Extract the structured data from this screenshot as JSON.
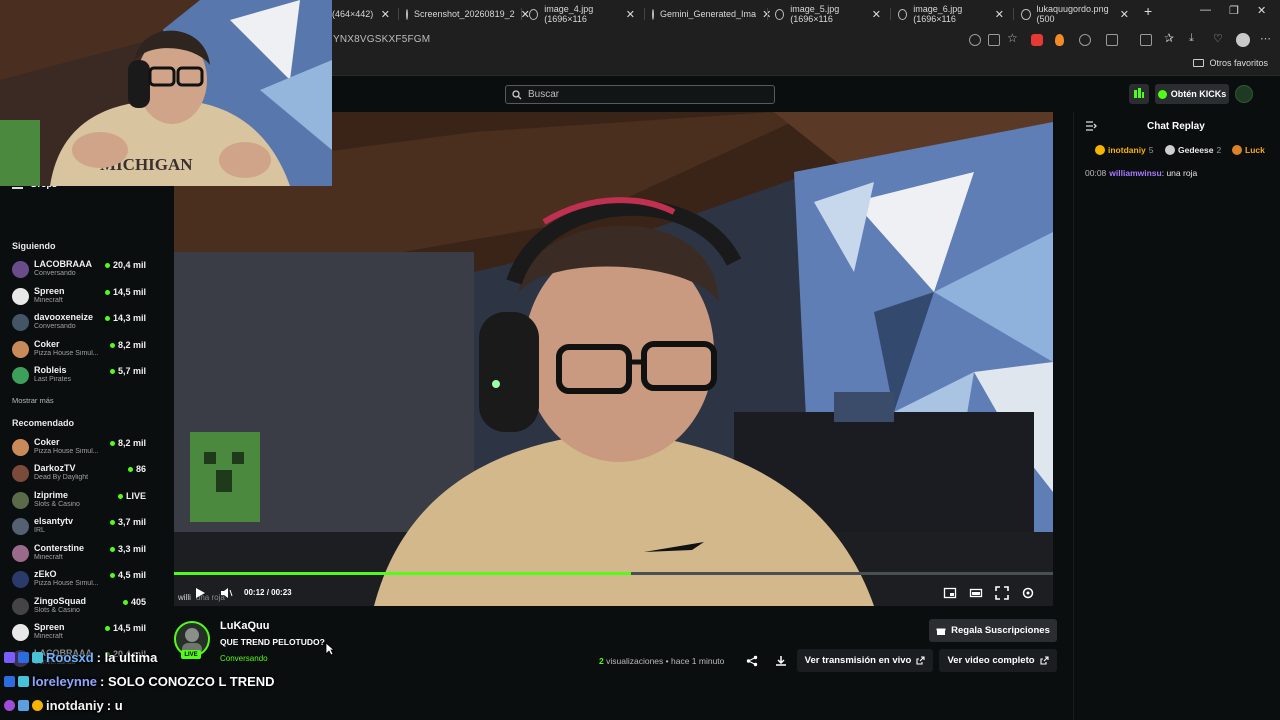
{
  "browser": {
    "tabs": [
      {
        "label": "(464×442)"
      },
      {
        "label": "Screenshot_20260819_2"
      },
      {
        "label": "image_4.jpg (1696×116"
      },
      {
        "label": "Gemini_Generated_Ima"
      },
      {
        "label": "image_5.jpg (1696×116"
      },
      {
        "label": "image_6.jpg (1696×116"
      },
      {
        "label": "lukaquugordo.png (500"
      }
    ],
    "url": "YNX8VGSKXF5FGM",
    "bookmarks_folder": "Otros favoritos"
  },
  "header": {
    "search_placeholder": "Buscar",
    "kicks_button": "Obtén KICKs"
  },
  "sidebar": {
    "partial_label": "Siguiendo",
    "drops_label": "Drops",
    "following_title": "Siguiendo",
    "following": [
      {
        "name": "LACOBRAAA",
        "category": "Conversando",
        "count": "20,4 mil",
        "color": "#6b4c8a"
      },
      {
        "name": "Spreen",
        "category": "Minecraft",
        "count": "14,5 mil",
        "color": "#e8e8e8"
      },
      {
        "name": "davooxeneize",
        "category": "Conversando",
        "count": "14,3 mil",
        "color": "#445566"
      },
      {
        "name": "Coker",
        "category": "Pizza House Simul...",
        "count": "8,2 mil",
        "color": "#c98a5a"
      },
      {
        "name": "Robleis",
        "category": "Last Pirates",
        "count": "5,7 mil",
        "color": "#3ca05a"
      }
    ],
    "show_more": "Mostrar más",
    "recommended_title": "Recomendado",
    "recommended": [
      {
        "name": "Coker",
        "category": "Pizza House Simul...",
        "count": "8,2 mil",
        "color": "#c98a5a"
      },
      {
        "name": "DarkozTV",
        "category": "Dead By Daylight",
        "count": "86",
        "color": "#7a4a3a"
      },
      {
        "name": "Iziprime",
        "category": "Slots & Casino",
        "count": "LIVE",
        "color": "#5a6a4a"
      },
      {
        "name": "elsantytv",
        "category": "IRL",
        "count": "3,7 mil",
        "color": "#556070"
      },
      {
        "name": "Conterstine",
        "category": "Minecraft",
        "count": "3,3 mil",
        "color": "#9a6a8a"
      },
      {
        "name": "zEkO",
        "category": "Pizza House Simul...",
        "count": "4,5 mil",
        "color": "#2a3a6a"
      },
      {
        "name": "ZingoSquad",
        "category": "Slots & Casino",
        "count": "405",
        "color": "#444444"
      },
      {
        "name": "Spreen",
        "category": "Minecraft",
        "count": "14,5 mil",
        "color": "#e8e8e8"
      },
      {
        "name": "LACOBRAAA",
        "category": "Conversando",
        "count": "20,4 mil",
        "color": "#6b4c8a"
      }
    ]
  },
  "player": {
    "current_time": "00:12",
    "duration": "00:23",
    "progress": 0.52,
    "video_watermark_user": "willi"
  },
  "channel": {
    "name": "LuKaQuu",
    "title": "QUE TREND PELOTUDO?",
    "category": "Conversando",
    "live_label": "LIVE",
    "subs_button": "Regala Suscripciones",
    "views_count": "2",
    "views_text": "visualizaciones",
    "time_ago": "hace 1 minuto",
    "live_button": "Ver transmisión en vivo",
    "full_video_button": "Ver video completo"
  },
  "chat": {
    "title": "Chat Replay",
    "gifters": [
      {
        "name": "inotdaniy",
        "count": "5",
        "color": "#f5b400",
        "badge": "#f5b400"
      },
      {
        "name": "Gedeese",
        "count": "2",
        "color": "#e8e8e8",
        "badge": "#cfcfcf"
      },
      {
        "name": "Luck",
        "count": "",
        "color": "#f5a623",
        "badge": "#d9822b"
      }
    ],
    "message": {
      "time": "00:08",
      "user": "williamwinsu",
      "text": "una roja"
    }
  },
  "overlay_chat": [
    {
      "user": "Roosxd",
      "text": ": la ultima"
    },
    {
      "user": "loreleynne",
      "text": ": SOLO CONOZCO L TREND"
    },
    {
      "user": "inotdaniy",
      "text": ": u"
    }
  ],
  "colors": {
    "accent": "#53fc18",
    "background": "#0b0e0f",
    "chat_user": "#a679ff"
  }
}
